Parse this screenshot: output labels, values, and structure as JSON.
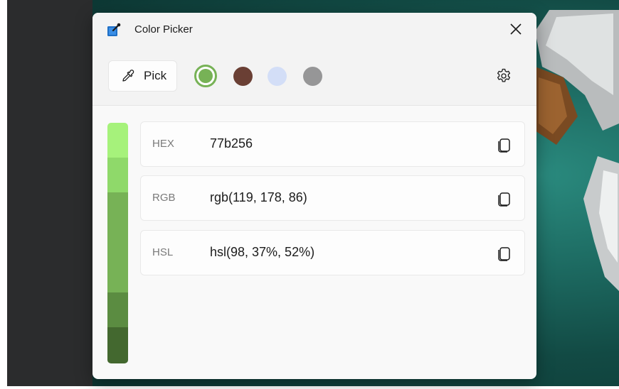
{
  "window": {
    "title": "Color Picker",
    "app_icon": "color-picker-app-icon",
    "close_icon": "close-icon"
  },
  "toolbar": {
    "pick_label": "Pick",
    "pick_icon": "eyedropper-icon",
    "settings_icon": "gear-icon",
    "swatches": [
      {
        "color": "#77b256",
        "selected": true
      },
      {
        "color": "#6a3f34",
        "selected": false
      },
      {
        "color": "#d3def7",
        "selected": false
      },
      {
        "color": "#969697",
        "selected": false
      }
    ]
  },
  "shades": [
    "#a6f27b",
    "#8fd96a",
    "#77b256",
    "#77b256",
    "#5b8c41",
    "#43682f"
  ],
  "formats": [
    {
      "label": "HEX",
      "value": "77b256",
      "copy_icon": "copy-icon"
    },
    {
      "label": "RGB",
      "value": "rgb(119, 178, 86)",
      "copy_icon": "copy-icon"
    },
    {
      "label": "HSL",
      "value": "hsl(98, 37%, 52%)",
      "copy_icon": "copy-icon"
    }
  ]
}
